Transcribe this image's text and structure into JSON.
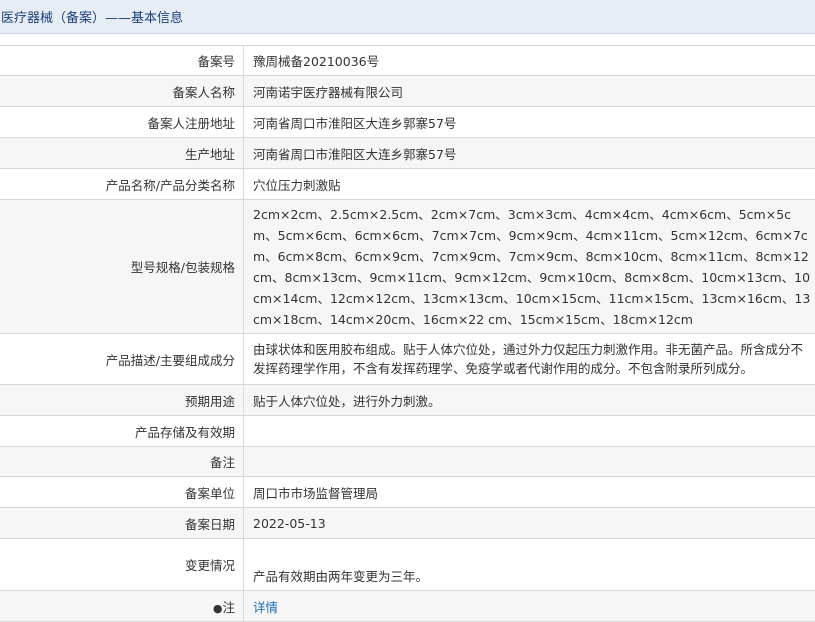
{
  "header": {
    "title": "医疗器械（备案）——基本信息"
  },
  "rows": [
    {
      "label": "备案号",
      "value": "豫周械备20210036号"
    },
    {
      "label": "备案人名称",
      "value": "河南诺宇医疗器械有限公司"
    },
    {
      "label": "备案人注册地址",
      "value": "河南省周口市淮阳区大连乡郭寨57号"
    },
    {
      "label": "生产地址",
      "value": "河南省周口市淮阳区大连乡郭寨57号"
    },
    {
      "label": "产品名称/产品分类名称",
      "value": "穴位压力刺激贴"
    },
    {
      "label": "型号规格/包装规格",
      "value": "2cm×2cm、2.5cm×2.5cm、2cm×7cm、3cm×3cm、4cm×4cm、4cm×6cm、5cm×5cm、5cm×6cm、6cm×6cm、7cm×7cm、9cm×9cm、4cm×11cm、5cm×12cm、6cm×7cm、6cm×8cm、6cm×9cm、7cm×9cm、7cm×9cm、8cm×10cm、8cm×11cm、8cm×12cm、8cm×13cm、9cm×11cm、9cm×12cm、9cm×10cm、8cm×8cm、10cm×13cm、10cm×14cm、12cm×12cm、13cm×13cm、10cm×15cm、11cm×15cm、13cm×16cm、13cm×18cm、14cm×20cm、16cm×22 cm、15cm×15cm、18cm×12cm"
    },
    {
      "label": "产品描述/主要组成成分",
      "value": "由球状体和医用胶布组成。贴于人体穴位处，通过外力仅起压力刺激作用。非无菌产品。所含成分不发挥药理学作用，不含有发挥药理学、免疫学或者代谢作用的成分。不包含附录所列成分。"
    },
    {
      "label": "预期用途",
      "value": "贴于人体穴位处，进行外力刺激。"
    },
    {
      "label": "产品存储及有效期",
      "value": ""
    },
    {
      "label": "备注",
      "value": ""
    },
    {
      "label": "备案单位",
      "value": "周口市市场监督管理局"
    },
    {
      "label": "备案日期",
      "value": "2022-05-13"
    },
    {
      "label": "变更情况",
      "value": "产品有效期由两年变更为三年。"
    },
    {
      "label": "注",
      "dot": "●",
      "value": "详情"
    }
  ],
  "colors": {
    "header_bg": "#e6edf5",
    "header_text": "#1c3e7a",
    "link": "#1a6fb8",
    "stripe": "#f6f6f6"
  }
}
